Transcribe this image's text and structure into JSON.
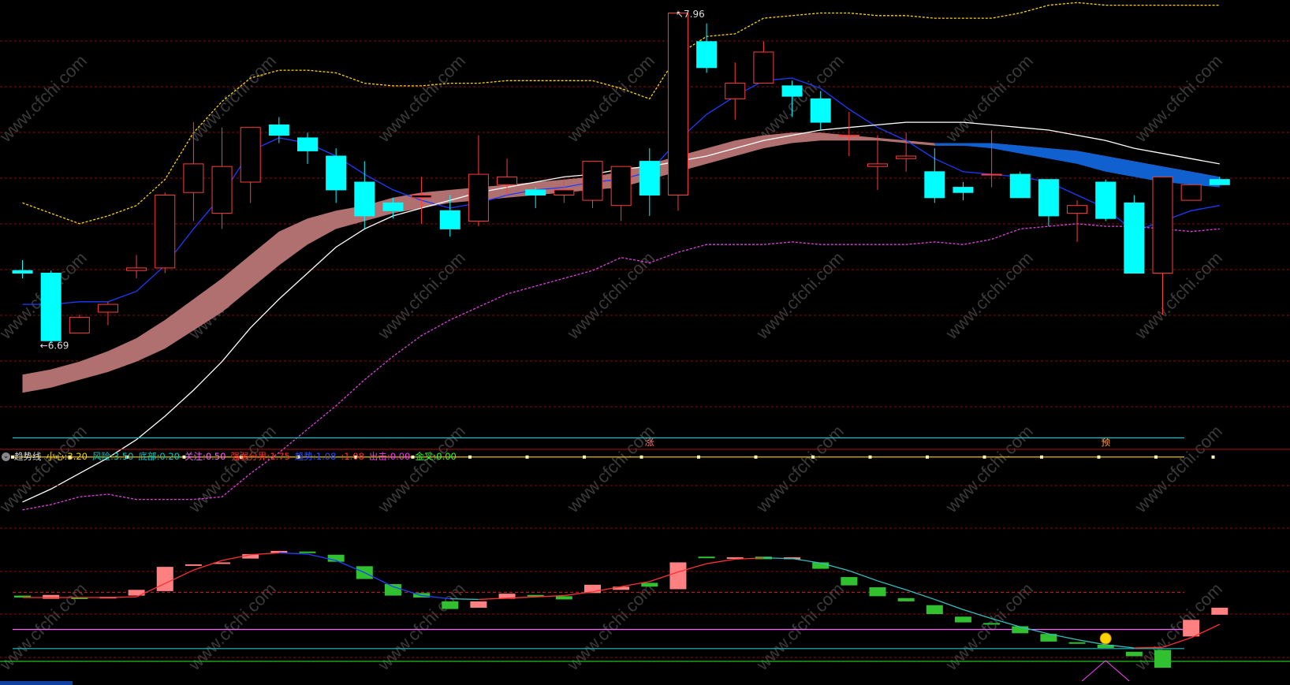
{
  "indicator_bar": {
    "name": "趋势线",
    "items": [
      {
        "label": "小心:",
        "value": "3.20",
        "label_color": "#ffd400",
        "value_color": "#ffd400"
      },
      {
        "label": "风险:",
        "value": "3.50",
        "label_color": "#00c8c8",
        "value_color": "#00c8c8"
      },
      {
        "label": "底部:",
        "value": "0.20",
        "label_color": "#00c8c8",
        "value_color": "#00c8c8"
      },
      {
        "label": "关注:",
        "value": "0.50",
        "label_color": "#ff60ff",
        "value_color": "#ff60ff"
      },
      {
        "label": "强弱分界:",
        "value": "1.75",
        "label_color": "#ff3030",
        "value_color": "#ff3030"
      },
      {
        "label": "趋势:",
        "value": "1.08",
        "label_color": "#3050ff",
        "value_color": "#3050ff"
      },
      {
        "label": ":",
        "value": "1.08",
        "label_color": "#ff3030",
        "value_color": "#ff3030"
      },
      {
        "label": "出击:",
        "value": "0.00",
        "label_color": "#ff30ff",
        "value_color": "#ff30ff"
      },
      {
        "label": "金叉:",
        "value": "0.00",
        "label_color": "#30ff30",
        "value_color": "#30ff30"
      }
    ]
  },
  "markers": {
    "high_label": "7.96",
    "low_label": "6.69",
    "signal_1": "涨",
    "signal_2": "预"
  },
  "watermark": "www.cfchi.com",
  "colors": {
    "up": "#ff3b3b",
    "down": "#00ffff",
    "bg": "#000000",
    "grid": "#7a1010"
  },
  "chart_data": [
    {
      "type": "candlestick",
      "title": "",
      "series": [
        {
          "name": "",
          "kind": "ohlc",
          "values": [
            [
              6.96,
              7.0,
              6.93,
              6.95
            ],
            [
              6.95,
              6.96,
              6.68,
              6.69
            ],
            [
              6.72,
              6.79,
              6.72,
              6.78
            ],
            [
              6.8,
              6.84,
              6.75,
              6.83
            ],
            [
              6.96,
              7.02,
              6.93,
              6.97
            ],
            [
              6.97,
              7.26,
              6.95,
              7.25
            ],
            [
              7.26,
              7.53,
              7.15,
              7.37
            ],
            [
              7.18,
              7.51,
              7.12,
              7.36
            ],
            [
              7.3,
              7.5,
              7.22,
              7.51
            ],
            [
              7.52,
              7.55,
              7.45,
              7.48
            ],
            [
              7.47,
              7.49,
              7.37,
              7.42
            ],
            [
              7.4,
              7.43,
              7.22,
              7.27
            ],
            [
              7.3,
              7.38,
              7.12,
              7.17
            ],
            [
              7.22,
              7.24,
              7.16,
              7.19
            ],
            [
              7.24,
              7.32,
              7.14,
              7.25
            ],
            [
              7.19,
              7.25,
              7.09,
              7.12
            ],
            [
              7.15,
              7.48,
              7.13,
              7.33
            ],
            [
              7.29,
              7.39,
              7.25,
              7.32
            ],
            [
              7.27,
              7.28,
              7.2,
              7.25
            ],
            [
              7.25,
              7.31,
              7.22,
              7.27
            ],
            [
              7.23,
              7.38,
              7.2,
              7.38
            ],
            [
              7.21,
              7.36,
              7.15,
              7.36
            ],
            [
              7.38,
              7.43,
              7.17,
              7.25
            ],
            [
              7.25,
              7.96,
              7.19,
              7.95
            ],
            [
              7.84,
              7.91,
              7.72,
              7.74
            ],
            [
              7.62,
              7.76,
              7.54,
              7.68
            ],
            [
              7.68,
              7.84,
              7.69,
              7.8
            ],
            [
              7.67,
              7.69,
              7.55,
              7.63
            ],
            [
              7.62,
              7.65,
              7.5,
              7.53
            ],
            [
              7.48,
              7.57,
              7.4,
              7.48
            ],
            [
              7.36,
              7.48,
              7.27,
              7.37
            ],
            [
              7.39,
              7.49,
              7.34,
              7.4
            ],
            [
              7.34,
              7.43,
              7.22,
              7.24
            ],
            [
              7.28,
              7.3,
              7.23,
              7.26
            ],
            [
              7.33,
              7.5,
              7.28,
              7.33
            ],
            [
              7.33,
              7.34,
              7.24,
              7.24
            ],
            [
              7.31,
              7.31,
              7.13,
              7.17
            ],
            [
              7.18,
              7.23,
              7.07,
              7.21
            ],
            [
              7.3,
              7.31,
              7.15,
              7.16
            ],
            [
              7.22,
              7.25,
              7.0,
              6.95
            ],
            [
              6.95,
              7.32,
              6.79,
              7.32
            ],
            [
              7.23,
              7.29,
              7.26,
              7.29
            ],
            [
              7.31,
              7.32,
              7.29,
              7.29
            ]
          ]
        },
        {
          "name": "",
          "kind": "line",
          "color": "#1a3cff",
          "values": [
            6.83,
            6.83,
            6.84,
            6.84,
            6.88,
            6.98,
            7.12,
            7.25,
            7.42,
            7.47,
            7.45,
            7.4,
            7.33,
            7.27,
            7.23,
            7.2,
            7.22,
            7.25,
            7.27,
            7.28,
            7.3,
            7.31,
            7.34,
            7.46,
            7.56,
            7.63,
            7.69,
            7.7,
            7.66,
            7.58,
            7.51,
            7.46,
            7.39,
            7.34,
            7.33,
            7.32,
            7.3,
            7.25,
            7.2,
            7.11,
            7.15,
            7.19,
            7.21
          ]
        },
        {
          "name": "",
          "kind": "line",
          "color": "#ffffff",
          "values": [
            6.07,
            6.12,
            6.18,
            6.24,
            6.31,
            6.4,
            6.5,
            6.61,
            6.74,
            6.85,
            6.95,
            7.05,
            7.12,
            7.17,
            7.2,
            7.23,
            7.26,
            7.28,
            7.3,
            7.32,
            7.33,
            7.35,
            7.36,
            7.38,
            7.4,
            7.43,
            7.46,
            7.48,
            7.5,
            7.51,
            7.52,
            7.53,
            7.53,
            7.53,
            7.52,
            7.51,
            7.5,
            7.48,
            7.46,
            7.43,
            7.41,
            7.39,
            7.37
          ]
        },
        {
          "name": "",
          "kind": "band",
          "color": "#b07070",
          "upper": [
            6.56,
            6.58,
            6.61,
            6.65,
            6.7,
            6.77,
            6.85,
            6.93,
            7.02,
            7.11,
            7.16,
            7.19,
            7.21,
            7.24,
            7.26,
            7.27,
            7.28,
            7.29,
            7.3,
            7.31,
            7.32,
            7.34,
            7.37,
            7.4,
            7.43,
            7.46,
            7.48,
            7.49,
            7.49,
            7.48,
            7.47,
            7.46,
            7.45,
            7.45,
            7.45,
            7.44,
            7.43,
            7.42,
            7.4,
            7.38,
            7.36,
            7.34,
            7.32
          ],
          "lower": [
            6.49,
            6.51,
            6.54,
            6.57,
            6.61,
            6.66,
            6.73,
            6.8,
            6.89,
            6.98,
            7.06,
            7.12,
            7.15,
            7.18,
            7.2,
            7.22,
            7.23,
            7.24,
            7.25,
            7.26,
            7.27,
            7.28,
            7.31,
            7.34,
            7.37,
            7.4,
            7.43,
            7.45,
            7.46,
            7.46,
            7.46,
            7.45,
            7.44,
            7.44,
            7.44,
            7.43,
            7.42,
            7.41,
            7.39,
            7.37,
            7.35,
            7.33,
            7.31
          ]
        },
        {
          "name": "",
          "kind": "band",
          "color": "#1060d0",
          "upper": [
            null,
            null,
            null,
            null,
            null,
            null,
            null,
            null,
            null,
            null,
            null,
            null,
            null,
            null,
            null,
            null,
            null,
            null,
            null,
            null,
            null,
            null,
            null,
            null,
            null,
            null,
            null,
            null,
            null,
            null,
            null,
            null,
            7.45,
            7.45,
            7.45,
            7.44,
            7.43,
            7.42,
            7.4,
            7.38,
            7.36,
            7.34,
            7.32
          ],
          "lower": [
            null,
            null,
            null,
            null,
            null,
            null,
            null,
            null,
            null,
            null,
            null,
            null,
            null,
            null,
            null,
            null,
            null,
            null,
            null,
            null,
            null,
            null,
            null,
            null,
            null,
            null,
            null,
            null,
            null,
            null,
            null,
            null,
            7.44,
            7.44,
            7.43,
            7.41,
            7.39,
            7.37,
            7.34,
            7.32,
            7.3,
            7.29,
            7.28
          ]
        },
        {
          "name": "",
          "kind": "line",
          "color": "#ffd400",
          "dash": true,
          "values": [
            7.22,
            7.18,
            7.14,
            7.17,
            7.21,
            7.31,
            7.49,
            7.61,
            7.7,
            7.73,
            7.73,
            7.72,
            7.68,
            7.67,
            7.67,
            7.68,
            7.68,
            7.69,
            7.69,
            7.69,
            7.69,
            7.66,
            7.62,
            7.79,
            7.86,
            7.87,
            7.93,
            7.94,
            7.95,
            7.95,
            7.94,
            7.94,
            7.93,
            7.93,
            7.93,
            7.95,
            7.98,
            7.99,
            7.98,
            7.98,
            7.98,
            7.98,
            7.98
          ]
        },
        {
          "name": "",
          "kind": "line",
          "color": "#e040e0",
          "dash": true,
          "values": [
            6.04,
            6.06,
            6.09,
            6.1,
            6.08,
            6.08,
            6.08,
            6.09,
            6.18,
            6.26,
            6.35,
            6.44,
            6.54,
            6.63,
            6.71,
            6.77,
            6.82,
            6.87,
            6.9,
            6.93,
            6.96,
            7.01,
            6.99,
            7.03,
            7.06,
            7.06,
            7.06,
            7.07,
            7.06,
            7.06,
            7.06,
            7.06,
            7.07,
            7.06,
            7.08,
            7.12,
            7.13,
            7.14,
            7.13,
            7.13,
            7.12,
            7.11,
            7.12
          ]
        }
      ],
      "y_range": [
        6.0,
        8.0
      ],
      "grid": true,
      "watermark": "www.cfchi.com"
    },
    {
      "type": "bar",
      "title": "趋势线",
      "series": [
        {
          "name": "",
          "kind": "bars",
          "values": [
            [
              1.03,
              1.0
            ],
            [
              0.98,
              1.04
            ],
            [
              1.0,
              0.98
            ],
            [
              1.0,
              1.01
            ],
            [
              1.03,
              1.12
            ],
            [
              1.1,
              1.48
            ],
            [
              1.5,
              1.52
            ],
            [
              1.54,
              1.55
            ],
            [
              1.61,
              1.68
            ],
            [
              1.69,
              1.73
            ],
            [
              1.72,
              1.7
            ],
            [
              1.67,
              1.56
            ],
            [
              1.49,
              1.29
            ],
            [
              1.21,
              1.03
            ],
            [
              1.07,
              1.0
            ],
            [
              0.94,
              0.82
            ],
            [
              0.84,
              0.94
            ],
            [
              0.98,
              1.06
            ],
            [
              1.04,
              1.03
            ],
            [
              1.02,
              0.97
            ],
            [
              1.07,
              1.2
            ],
            [
              1.12,
              1.17
            ],
            [
              1.23,
              1.17
            ],
            [
              1.13,
              1.55
            ],
            [
              1.64,
              1.63
            ],
            [
              1.63,
              1.63
            ],
            [
              1.64,
              1.6
            ],
            [
              1.6,
              1.63
            ],
            [
              1.55,
              1.45
            ],
            [
              1.32,
              1.19
            ],
            [
              1.16,
              1.02
            ],
            [
              0.99,
              0.94
            ],
            [
              0.88,
              0.74
            ],
            [
              0.7,
              0.61
            ],
            [
              0.6,
              0.59
            ],
            [
              0.55,
              0.44
            ],
            [
              0.43,
              0.31
            ],
            [
              0.3,
              0.29
            ],
            [
              0.26,
              0.21
            ],
            [
              0.15,
              0.08
            ],
            [
              0.18,
              -0.1
            ],
            [
              0.39,
              0.65
            ],
            [
              0.73,
              0.84
            ]
          ]
        },
        {
          "name": "",
          "kind": "line",
          "color": "#ff3030",
          "values": [
            1.0,
            1.0,
            1.0,
            1.0,
            1.01,
            1.22,
            1.43,
            1.58,
            1.67,
            1.7,
            1.68,
            1.58,
            1.39,
            1.17,
            1.03,
            0.98,
            0.97,
            0.99,
            1.01,
            1.03,
            1.09,
            1.17,
            1.25,
            1.4,
            1.53,
            1.6,
            1.62,
            1.61,
            1.54,
            1.42,
            1.26,
            1.12,
            0.97,
            0.81,
            0.67,
            0.54,
            0.43,
            0.34,
            0.26,
            0.21,
            0.22,
            0.37,
            0.58
          ]
        }
      ],
      "hlines": [
        3.5,
        3.2,
        1.08,
        0.5,
        0.2,
        0.0
      ],
      "y_range": [
        0.0,
        3.6
      ],
      "grid": true
    }
  ]
}
